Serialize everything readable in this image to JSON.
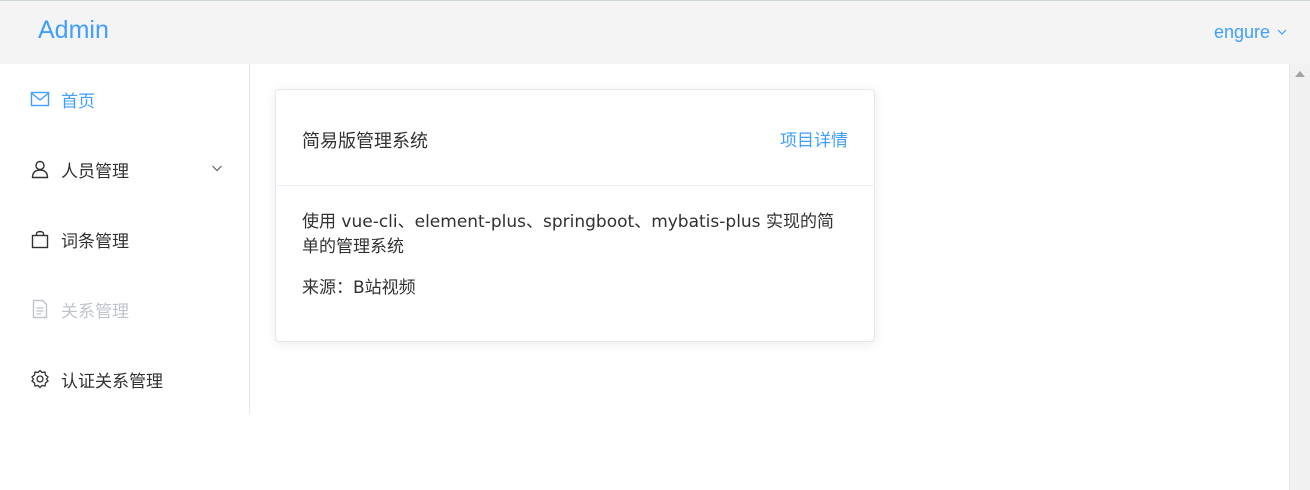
{
  "header": {
    "logo": "Admin",
    "user": "engure"
  },
  "sidebar": {
    "items": [
      {
        "label": "首页",
        "icon": "message-icon",
        "state": "active"
      },
      {
        "label": "人员管理",
        "icon": "user-icon",
        "state": "submenu"
      },
      {
        "label": "词条管理",
        "icon": "shopping-bag-icon",
        "state": "normal"
      },
      {
        "label": "关系管理",
        "icon": "document-icon",
        "state": "disabled"
      },
      {
        "label": "认证关系管理",
        "icon": "gear-icon",
        "state": "normal"
      }
    ]
  },
  "card": {
    "title": "简易版管理系统",
    "link": "项目详情",
    "description": "使用 vue-cli、element-plus、springboot、mybatis-plus 实现的简单的管理系统",
    "source": "来源：B站视频"
  },
  "colors": {
    "accent": "#409eff",
    "header_bg": "#f4f4f5",
    "disabled": "#c0c4cc"
  }
}
